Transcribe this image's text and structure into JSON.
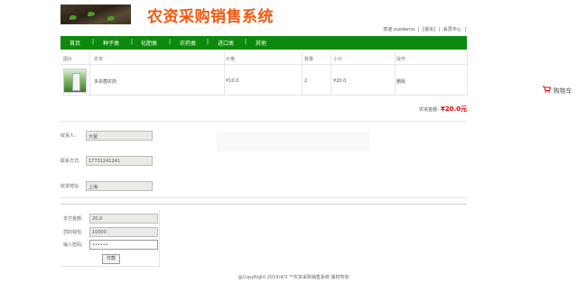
{
  "header": {
    "title": "农资采购销售系统"
  },
  "userbar": {
    "welcome": "欢迎:zuodama",
    "sep1": "|",
    "logout": "[退出]",
    "sep2": "|",
    "member_center": "会员中心",
    "sep3": "|"
  },
  "nav": {
    "items": [
      "首页",
      "种子类",
      "化肥类",
      "农药类",
      "进口类",
      "其他"
    ],
    "separator": "|"
  },
  "cart": {
    "columns": [
      "图片",
      "农资",
      "价格",
      "数量",
      "小计",
      "操作"
    ],
    "rows": [
      {
        "name": "多杀菌农药",
        "price": "¥10.0",
        "quantity": "2",
        "subtotal": "¥20.0",
        "action": "删除"
      }
    ],
    "total_label": "农资金额:",
    "total_value": "¥20.0元"
  },
  "side_cart": {
    "label": "购物车"
  },
  "order_form": {
    "receiver_label": "收货人：",
    "receiver_value": "大爸",
    "phone_label": "联系方式:",
    "phone_value": "17731241241",
    "address_label": "收货地址:",
    "address_value": "上海"
  },
  "payment": {
    "amount_label": "支付金额:",
    "amount_value": "20.0",
    "balance_label": "您的钱包:",
    "balance_value": "10000",
    "password_label": "输入密码:",
    "password_value": "••••••",
    "pay_button": "付款"
  },
  "footer": {
    "copyright": "@CopyRight 2019/4/3 **农资采购销售系统 版权所有"
  },
  "colors": {
    "nav_green": "#0d8a0d",
    "title_orange": "#f05a10",
    "price_red": "#d00000"
  }
}
